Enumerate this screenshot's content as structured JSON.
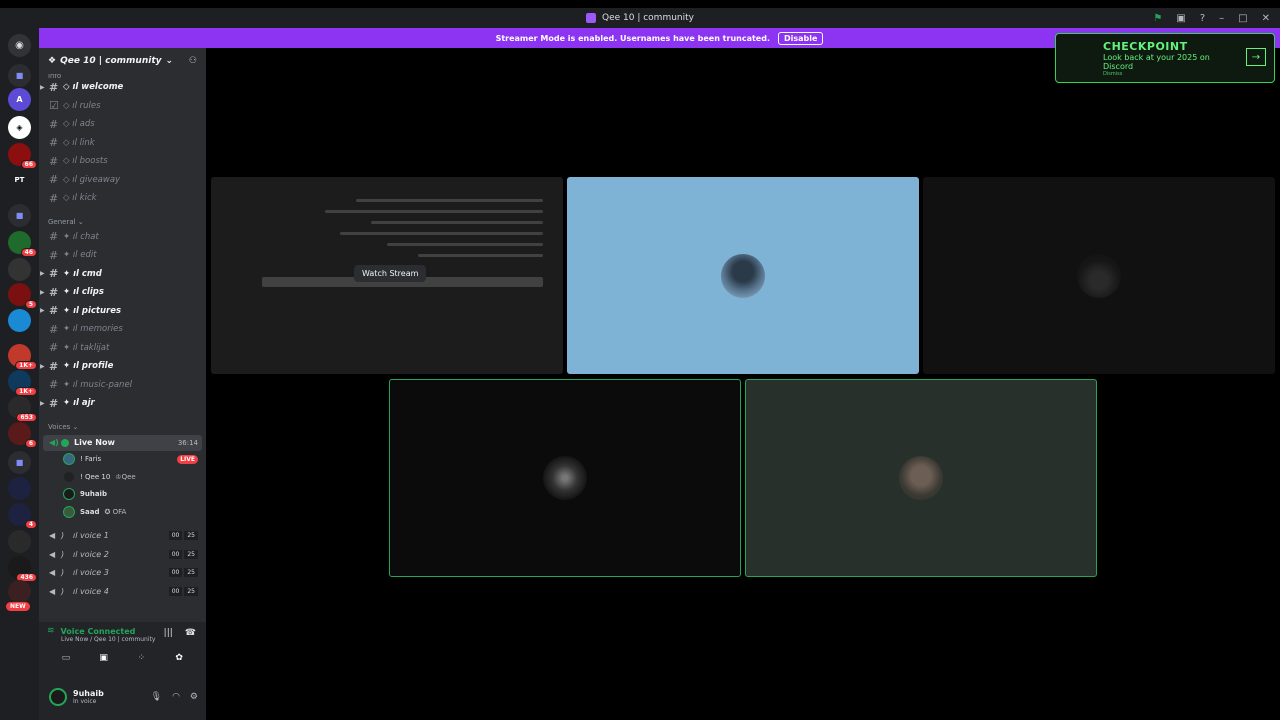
{
  "window": {
    "title": "Qee 10 | community"
  },
  "banner": {
    "text": "Streamer Mode is enabled. Usernames have been truncated.",
    "button": "Disable"
  },
  "server_rail": {
    "badges": [
      "46",
      "66",
      "46",
      "5",
      "1K+",
      "1K+",
      "653",
      "6",
      "4",
      "436"
    ],
    "new_label": "NEW",
    "label_pt": "PT"
  },
  "server": {
    "name": "Qee 10 | community",
    "top_category": "info",
    "channels_top": [
      {
        "name": "◇ ıl welcome",
        "bright": true,
        "arrow": true
      },
      {
        "name": "◇ ıl rules",
        "bright": false
      },
      {
        "name": "◇ ıl ads",
        "bright": false
      },
      {
        "name": "◇ ıl link",
        "bright": false
      },
      {
        "name": "◇ ıl boosts",
        "bright": false
      },
      {
        "name": "◇ ıl giveaway",
        "bright": false
      },
      {
        "name": "◇ ıl kick",
        "bright": false
      }
    ],
    "general_category": "General",
    "channels_general": [
      {
        "name": "✦ ıl chat",
        "bright": false
      },
      {
        "name": "✦ ıl edit",
        "bright": false
      },
      {
        "name": "✦ ıl cmd",
        "bright": true,
        "arrow": true
      },
      {
        "name": "✦ ıl clips",
        "bright": true,
        "arrow": true
      },
      {
        "name": "✦ ıl pictures",
        "bright": true,
        "arrow": true
      },
      {
        "name": "✦ ıl memories",
        "bright": false
      },
      {
        "name": "✦ ıl taklijat",
        "bright": false
      },
      {
        "name": "✦ ıl profile",
        "bright": true,
        "arrow": true
      },
      {
        "name": "✦ ıl music-panel",
        "bright": false
      },
      {
        "name": "✦ ıl ajr",
        "bright": true,
        "arrow": true
      }
    ],
    "voices_category": "Voices",
    "live_channel": {
      "name": "Live Now",
      "timer": "36:14"
    },
    "members": [
      {
        "name": "! Faris",
        "badge": "LIVE"
      },
      {
        "name": "! Qee 10",
        "sub": "♔Qee"
      },
      {
        "name": "9uhaib"
      },
      {
        "name": "Saad",
        "sub": "✪ OFA"
      }
    ],
    "voice_channels": [
      {
        "name": "ıl voice 1",
        "a": "00",
        "b": "25"
      },
      {
        "name": "ıl voice 2",
        "a": "00",
        "b": "25"
      },
      {
        "name": "ıl voice 3",
        "a": "00",
        "b": "25"
      },
      {
        "name": "ıl voice 4",
        "a": "00",
        "b": "25"
      }
    ]
  },
  "voice_panel": {
    "status": "Voice Connected",
    "location": "Live Now / Qee 10 | community"
  },
  "user": {
    "name": "9uhaib",
    "status": "In voice"
  },
  "stage": {
    "watch_label": "Watch Stream"
  },
  "checkpoint": {
    "title": "CHECKPOINT",
    "subtitle": "Look back at your 2025 on Discord",
    "dismiss": "Dismiss"
  }
}
